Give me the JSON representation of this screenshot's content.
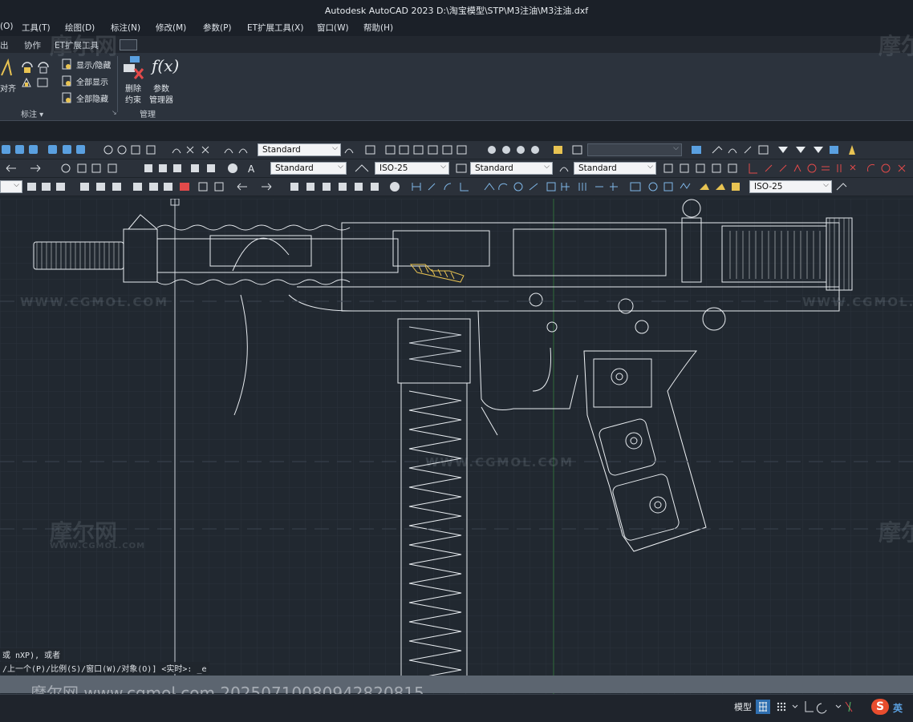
{
  "window": {
    "title": "Autodesk AutoCAD 2023    D:\\淘宝模型\\STP\\M3注油\\M3注油.dxf"
  },
  "menu": [
    "(O)",
    "工具(T)",
    "绘图(D)",
    "标注(N)",
    "修改(M)",
    "参数(P)",
    "ET扩展工具(X)",
    "窗口(W)",
    "帮助(H)"
  ],
  "ribbon_tabs": [
    "出",
    "协作",
    "ET扩展工具"
  ],
  "ribbon": {
    "align_label": "对齐",
    "show_hide": "显示/隐藏",
    "show_all": "全部显示",
    "hide_all": "全部隐藏",
    "delete_constraint_1": "删除",
    "delete_constraint_2": "约束",
    "param_manager_1": "参数",
    "param_manager_2": "管理器",
    "panel_annotate": "标注 ▾",
    "panel_manage": "管理",
    "fx_symbol": "f(x)"
  },
  "toolbars": {
    "row1_style": "Standard",
    "row2_text_style": "Standard",
    "row2_dim_style": "ISO-25",
    "row2_table_style": "Standard",
    "row2_mleader_style": "Standard",
    "row3_dim_style": "ISO-25"
  },
  "watermarks": {
    "brand_cn": "摩尔网",
    "brand_url": "WWW.CGMOL.COM",
    "bottom_line": "摩尔网 www.cgmol.com 20250710080942820815"
  },
  "command_line": {
    "line1": "或 nXP), 或者",
    "line2": "/上一个(P)/比例(S)/窗口(W)/对象(O)] <实时>: _e"
  },
  "status_bar": {
    "model_label": "模型",
    "ime_label": "英"
  },
  "colors": {
    "title_bg": "#1b2028",
    "ribbon_bg": "#2c333d",
    "canvas_bg": "#212830",
    "status_bg": "#1f242c",
    "accent_blue": "#2f6fb0"
  }
}
